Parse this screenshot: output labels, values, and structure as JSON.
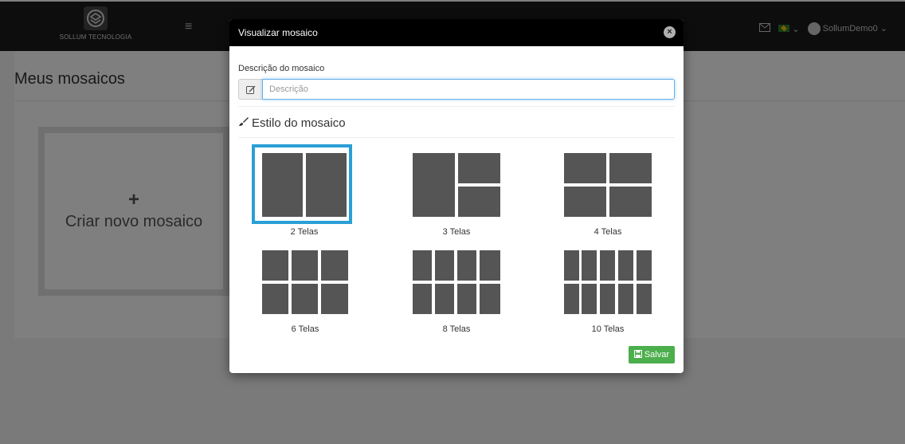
{
  "app": {
    "brand_small": "Sollum",
    "brand_name": "SOLLUM TECNOLOGIA",
    "user": "SollumDemo0"
  },
  "page": {
    "title": "Meus mosaicos",
    "create_plus": "+",
    "create_label": "Criar novo mosaico"
  },
  "modal": {
    "title": "Visualizar mosaico",
    "close": "×",
    "description_label": "Descrição do mosaico",
    "description_placeholder": "Descrição",
    "description_value": "",
    "style_title": "Estilo do mosaico",
    "options": [
      {
        "label": "2 Telas",
        "selected": true
      },
      {
        "label": "3 Telas",
        "selected": false
      },
      {
        "label": "4 Telas",
        "selected": false
      },
      {
        "label": "6 Telas",
        "selected": false
      },
      {
        "label": "8 Telas",
        "selected": false
      },
      {
        "label": "10 Telas",
        "selected": false
      }
    ],
    "save_label": "Salvar"
  },
  "colors": {
    "accent": "#2a9fd6",
    "save": "#4cae4c",
    "tile": "#555555"
  },
  "icons": [
    "menu-icon",
    "mail-icon",
    "flag-icon",
    "chevron-down-icon",
    "avatar-icon",
    "close-icon",
    "edit-icon",
    "brush-icon",
    "save-icon",
    "plus-icon"
  ]
}
